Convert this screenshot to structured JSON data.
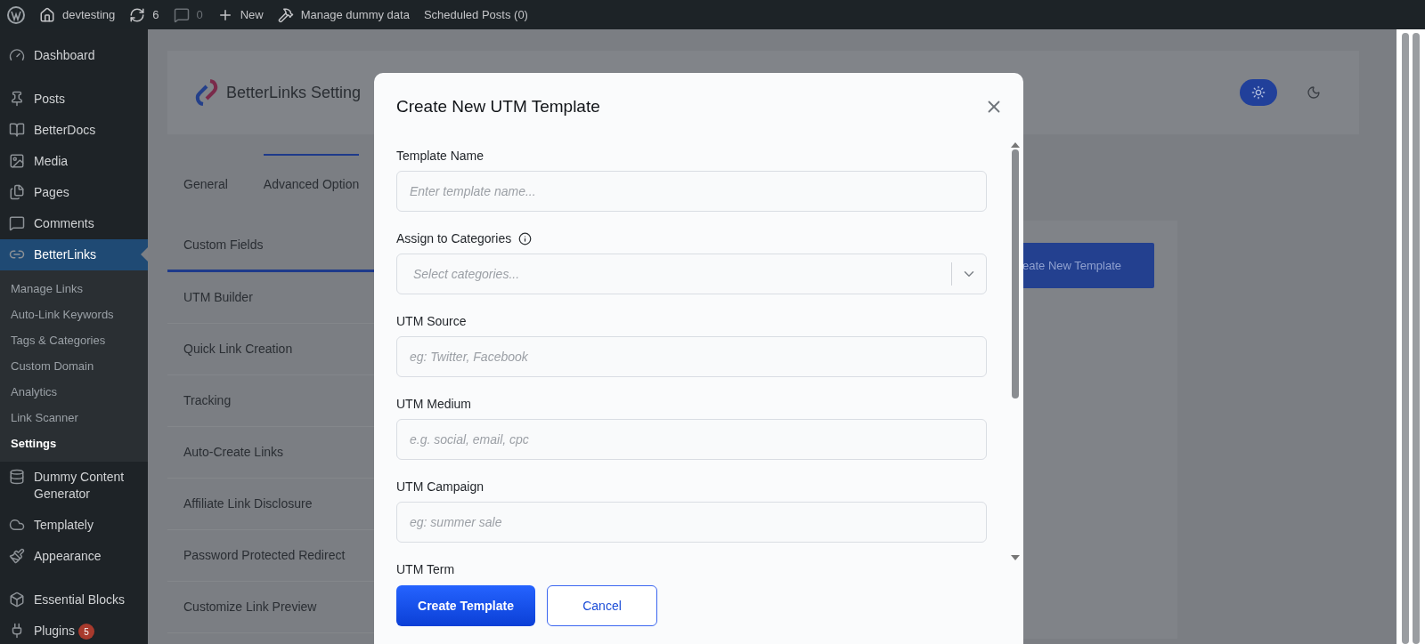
{
  "admin_bar": {
    "items": [
      {
        "kind": "logo"
      },
      {
        "kind": "home",
        "label": "devtesting"
      },
      {
        "kind": "updates",
        "label": "6"
      },
      {
        "kind": "comments",
        "label": "0"
      },
      {
        "kind": "new",
        "label": "New"
      },
      {
        "kind": "tool",
        "label": "Manage dummy data"
      },
      {
        "kind": "text",
        "label": "Scheduled Posts (0)"
      }
    ]
  },
  "sidebar": {
    "items": [
      {
        "kind": "dashboard",
        "label": "Dashboard",
        "selected": false
      },
      {
        "kind": "posts",
        "label": "Posts",
        "selected": false
      },
      {
        "kind": "docs",
        "label": "BetterDocs",
        "selected": false
      },
      {
        "kind": "media",
        "label": "Media",
        "selected": false
      },
      {
        "kind": "pages",
        "label": "Pages",
        "selected": false
      },
      {
        "kind": "comments",
        "label": "Comments",
        "selected": false
      },
      {
        "kind": "links",
        "label": "BetterLinks",
        "selected": true,
        "children": [
          {
            "label": "Manage Links",
            "selected": false
          },
          {
            "label": "Auto-Link Keywords",
            "selected": false
          },
          {
            "label": "Tags & Categories",
            "selected": false
          },
          {
            "label": "Custom Domain",
            "selected": false
          },
          {
            "label": "Analytics",
            "selected": false
          },
          {
            "label": "Link Scanner",
            "selected": false
          },
          {
            "label": "Settings",
            "selected": true
          }
        ]
      },
      {
        "kind": "database",
        "label": "Dummy Content Generator",
        "selected": false
      },
      {
        "kind": "cloud",
        "label": "Templately",
        "selected": false
      },
      {
        "kind": "appearance",
        "label": "Appearance",
        "selected": false
      },
      {
        "kind": "blocks",
        "label": "Essential Blocks",
        "selected": false
      },
      {
        "kind": "plugins",
        "label": "Plugins",
        "selected": false,
        "badge": "5"
      }
    ]
  },
  "settings_header": {
    "title": "BetterLinks Setting",
    "theme_modes": [
      {
        "kind": "light",
        "selected": true
      },
      {
        "kind": "dark",
        "selected": false
      }
    ]
  },
  "tabs": [
    {
      "label": "General",
      "selected": false
    },
    {
      "label": "Advanced Option",
      "selected": true
    }
  ],
  "settings_nav": [
    {
      "label": "Custom Fields",
      "selected": true
    },
    {
      "label": "UTM Builder",
      "selected": false
    },
    {
      "label": "Quick Link Creation",
      "selected": false
    },
    {
      "label": "Tracking",
      "selected": false
    },
    {
      "label": "Auto-Create Links",
      "selected": false
    },
    {
      "label": "Affiliate Link Disclosure",
      "selected": false
    },
    {
      "label": "Password Protected Redirect",
      "selected": false
    },
    {
      "label": "Customize Link Preview",
      "selected": false
    }
  ],
  "panel_button": "eate New Template",
  "modal": {
    "title": "Create New UTM Template",
    "fields": [
      {
        "kind": "text",
        "label": "Template Name",
        "placeholder": "Enter template name..."
      },
      {
        "kind": "select",
        "label": "Assign to Categories",
        "info": true,
        "placeholder": "Select categories..."
      },
      {
        "kind": "text",
        "label": "UTM Source",
        "placeholder": "eg: Twitter, Facebook"
      },
      {
        "kind": "text",
        "label": "UTM Medium",
        "placeholder": "e.g. social, email, cpc"
      },
      {
        "kind": "text",
        "label": "UTM Campaign",
        "placeholder": "eg: summer sale"
      },
      {
        "kind": "label",
        "label": "UTM Term"
      }
    ],
    "buttons": [
      {
        "kind": "primary",
        "label": "Create Template"
      },
      {
        "kind": "secondary",
        "label": "Cancel"
      }
    ]
  }
}
